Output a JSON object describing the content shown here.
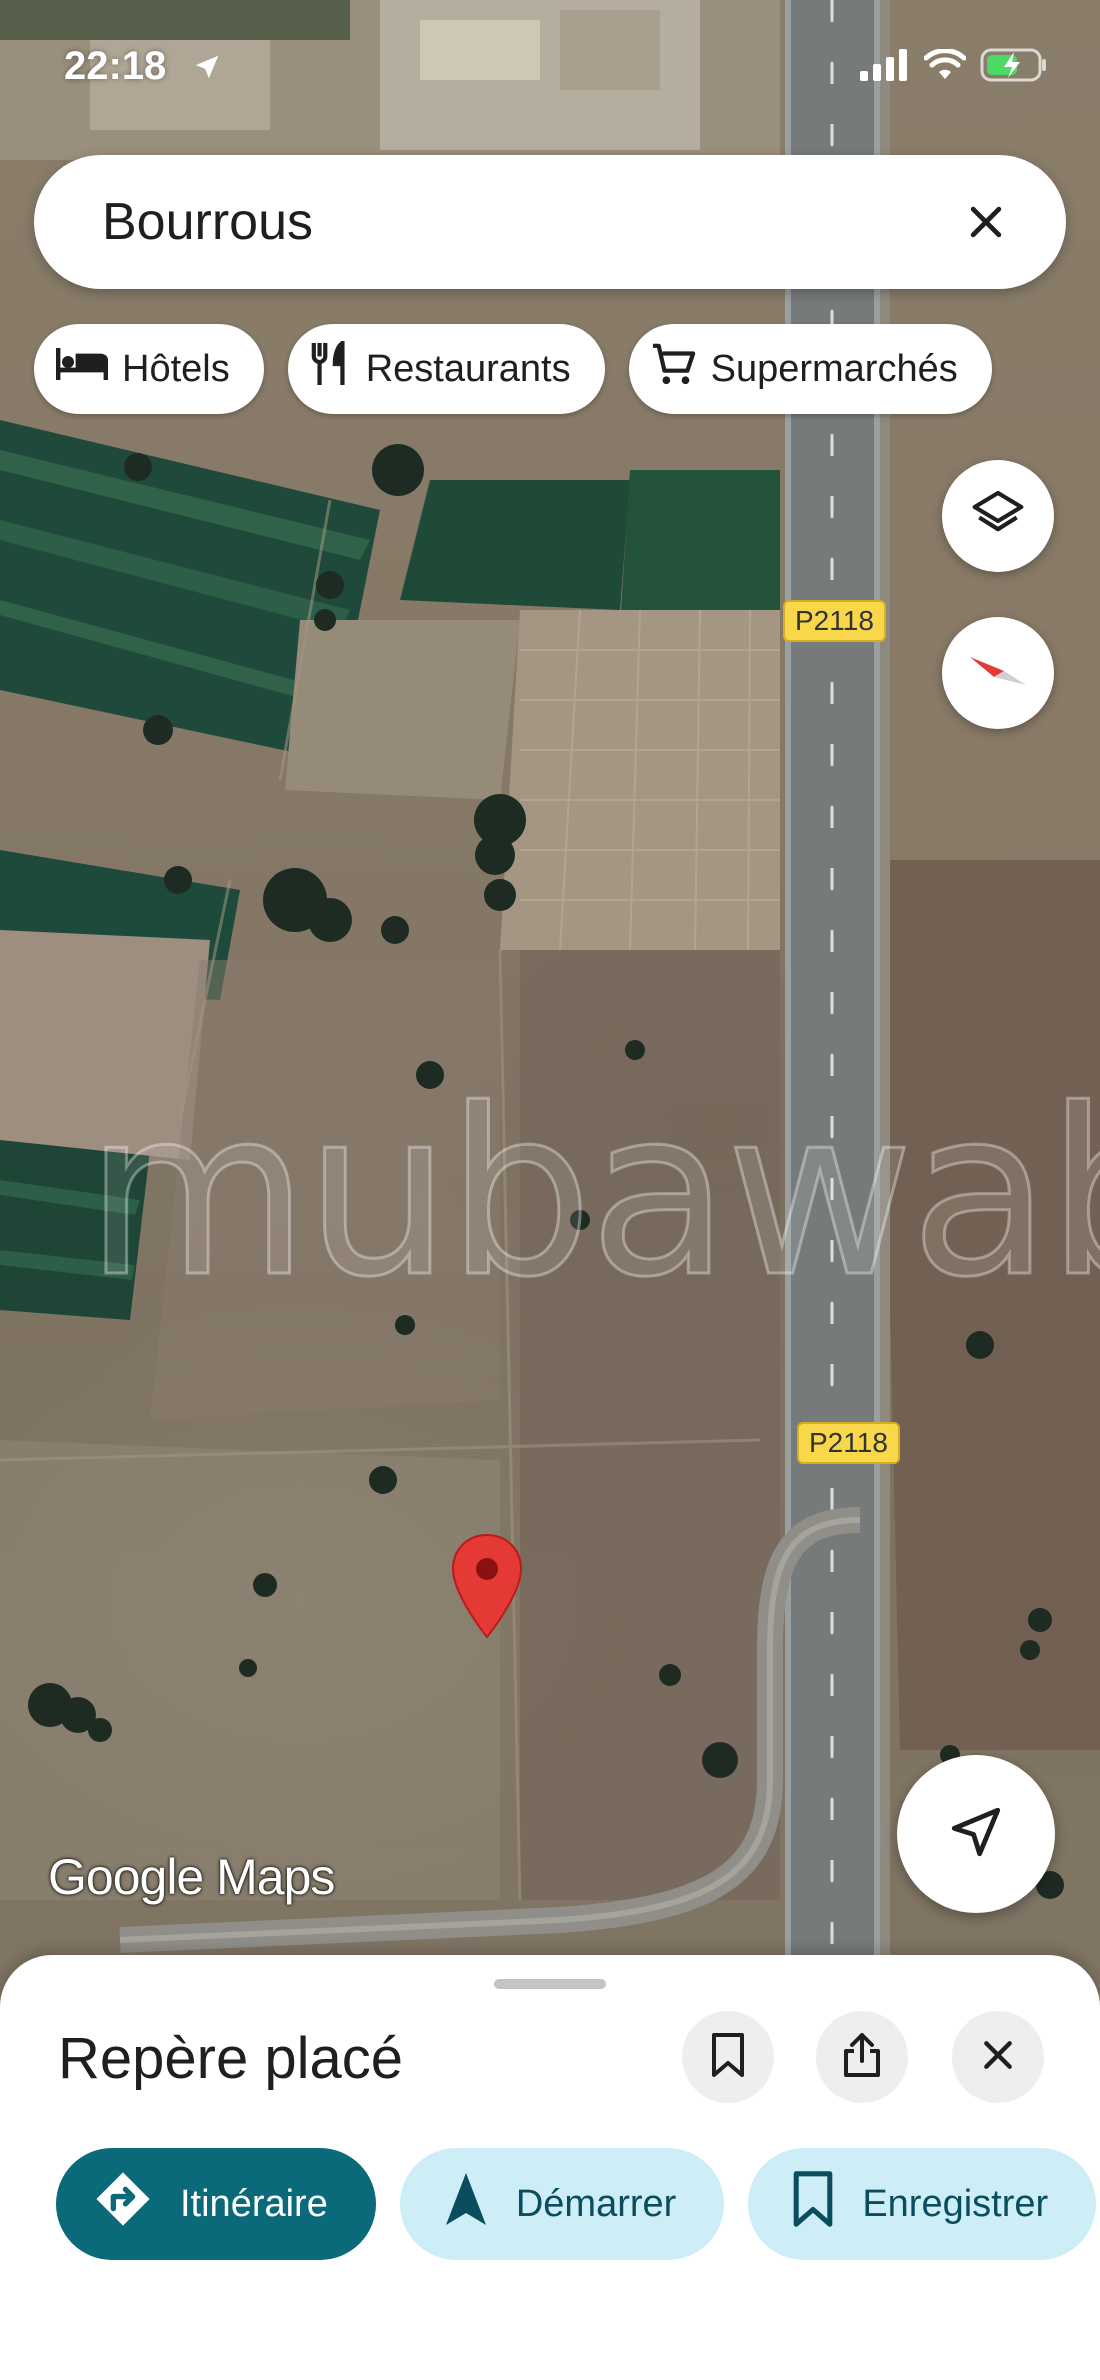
{
  "status_bar": {
    "time": "22:18",
    "icons": [
      "location-arrow-icon",
      "signal-icon",
      "wifi-icon",
      "battery-charging-icon"
    ]
  },
  "search": {
    "query": "Bourrous",
    "clear_icon": "close-icon"
  },
  "chips": [
    {
      "label": "Hôtels",
      "icon": "bed-icon"
    },
    {
      "label": "Restaurants",
      "icon": "fork-knife-icon"
    },
    {
      "label": "Supermarchés",
      "icon": "cart-icon"
    }
  ],
  "map": {
    "road_labels": [
      "P2118",
      "P2118"
    ],
    "watermark": "mubawab",
    "attribution": "Google Maps",
    "layers_icon": "layers-icon",
    "compass_icon": "compass-icon",
    "location_icon": "my-location-icon",
    "pin_icon": "map-pin-icon",
    "pin_color": "#e53935"
  },
  "sheet": {
    "title": "Repère placé",
    "icons": [
      "bookmark-icon",
      "share-icon",
      "close-icon"
    ],
    "actions": [
      {
        "label": "Itinéraire",
        "icon": "directions-icon",
        "style": "primary"
      },
      {
        "label": "Démarrer",
        "icon": "navigation-icon",
        "style": "secondary"
      },
      {
        "label": "Enregistrer",
        "icon": "bookmark-icon",
        "style": "secondary"
      }
    ]
  },
  "colors": {
    "primary": "#0b6a7a",
    "secondary_bg": "#cdeef6",
    "road_label_bg": "#f8d74a"
  }
}
